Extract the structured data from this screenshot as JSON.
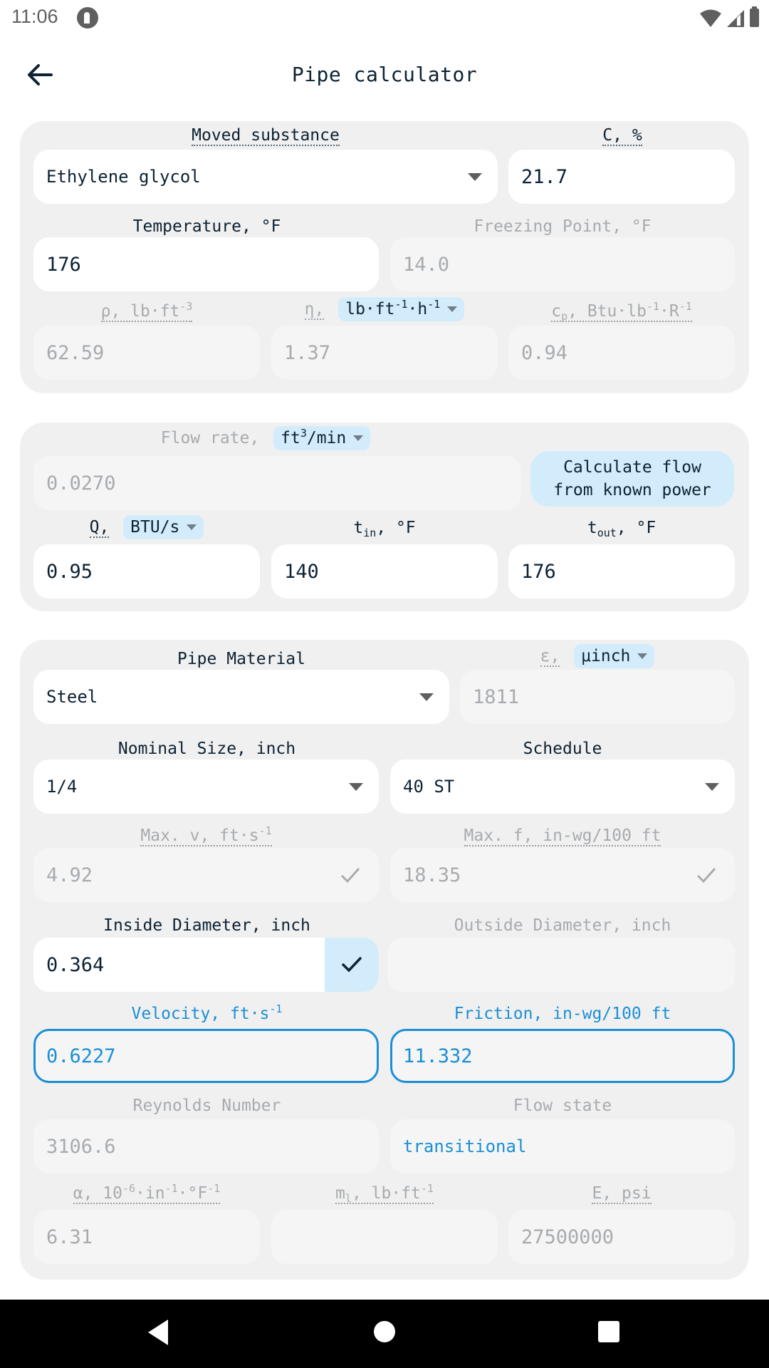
{
  "status_bar": {
    "time": "11:06",
    "icons": [
      "app-notification-icon",
      "wifi-icon",
      "signal-icon",
      "battery-icon"
    ]
  },
  "app_bar": {
    "title": "Pipe calculator",
    "back_icon": "arrow-back-icon"
  },
  "substance_card": {
    "moved_substance": {
      "label": "Moved substance",
      "value": "Ethylene glycol"
    },
    "concentration": {
      "label": "C, %",
      "value": "21.7"
    },
    "temperature": {
      "label": "Temperature, °F",
      "value": "176"
    },
    "freezing_point": {
      "label": "Freezing Point, °F",
      "value": "14.0"
    },
    "density": {
      "label_symbol": "ρ, lb·ft",
      "label_exp": "-3",
      "value": "62.59"
    },
    "viscosity": {
      "label_symbol": "η,",
      "unit_base": "lb·ft",
      "unit_exp1": "-1",
      "unit_mid": "·h",
      "unit_exp2": "-1",
      "value": "1.37"
    },
    "heat_capacity": {
      "label_symbol": "c",
      "label_sub": "p",
      "label_rest": ", Btu·lb",
      "label_exp1": "-1",
      "label_mid": "·R",
      "label_exp2": "-1",
      "value": "0.94"
    }
  },
  "flow_card": {
    "flow_rate": {
      "label": "Flow rate,",
      "unit_base": "ft",
      "unit_exp": "3",
      "unit_rest": "/min",
      "value": "0.0270"
    },
    "calculate_button": {
      "line1": "Calculate flow",
      "line2": "from known power"
    },
    "power": {
      "label": "Q,",
      "unit": "BTU/s",
      "value": "0.95"
    },
    "t_in": {
      "label_base": "t",
      "label_sub": "in",
      "label_rest": ", °F",
      "value": "140"
    },
    "t_out": {
      "label_base": "t",
      "label_sub": "out",
      "label_rest": ", °F",
      "value": "176"
    }
  },
  "pipe_card": {
    "pipe_material": {
      "label": "Pipe Material",
      "value": "Steel"
    },
    "roughness": {
      "label": "ε,",
      "unit": "μinch",
      "value": "1811"
    },
    "nominal_size": {
      "label": "Nominal Size, inch",
      "value": "1/4"
    },
    "schedule": {
      "label": "Schedule",
      "value": "40 ST"
    },
    "max_velocity": {
      "label_base": "Max. v, ft·s",
      "label_exp": "-1",
      "value": "4.92"
    },
    "max_friction": {
      "label": "Max. f, in-wg/100 ft",
      "value": "18.35"
    },
    "inside_diameter": {
      "label": "Inside Diameter, inch",
      "value": "0.364"
    },
    "outside_diameter": {
      "label": "Outside Diameter, inch",
      "value": ""
    },
    "velocity": {
      "label_base": "Velocity, ft·s",
      "label_exp": "-1",
      "value": "0.6227"
    },
    "friction": {
      "label": "Friction, in-wg/100 ft",
      "value": "11.332"
    },
    "reynolds": {
      "label": "Reynolds Number",
      "value": "3106.6"
    },
    "flow_state": {
      "label": "Flow state",
      "value": "transitional"
    },
    "thermal_expansion": {
      "label_a": "α, 10",
      "exp1": "-6",
      "label_b": "·in",
      "exp2": "-1",
      "label_c": "·°F",
      "exp3": "-1",
      "value": "6.31"
    },
    "linear_mass": {
      "label_a": "m",
      "sub": "l",
      "label_b": ", lb·ft",
      "exp": "-1",
      "value": ""
    },
    "elastic_modulus": {
      "label": "E, psi",
      "value": "27500000"
    }
  },
  "colors": {
    "accent_blue": "#1a8fd6",
    "chip_bg": "#d2ecfc",
    "card_bg": "#f0f0f0",
    "text_dark": "#0d2233",
    "text_muted": "#a7abaf"
  },
  "nav_bar": {
    "buttons": [
      "back",
      "home",
      "recents"
    ]
  }
}
